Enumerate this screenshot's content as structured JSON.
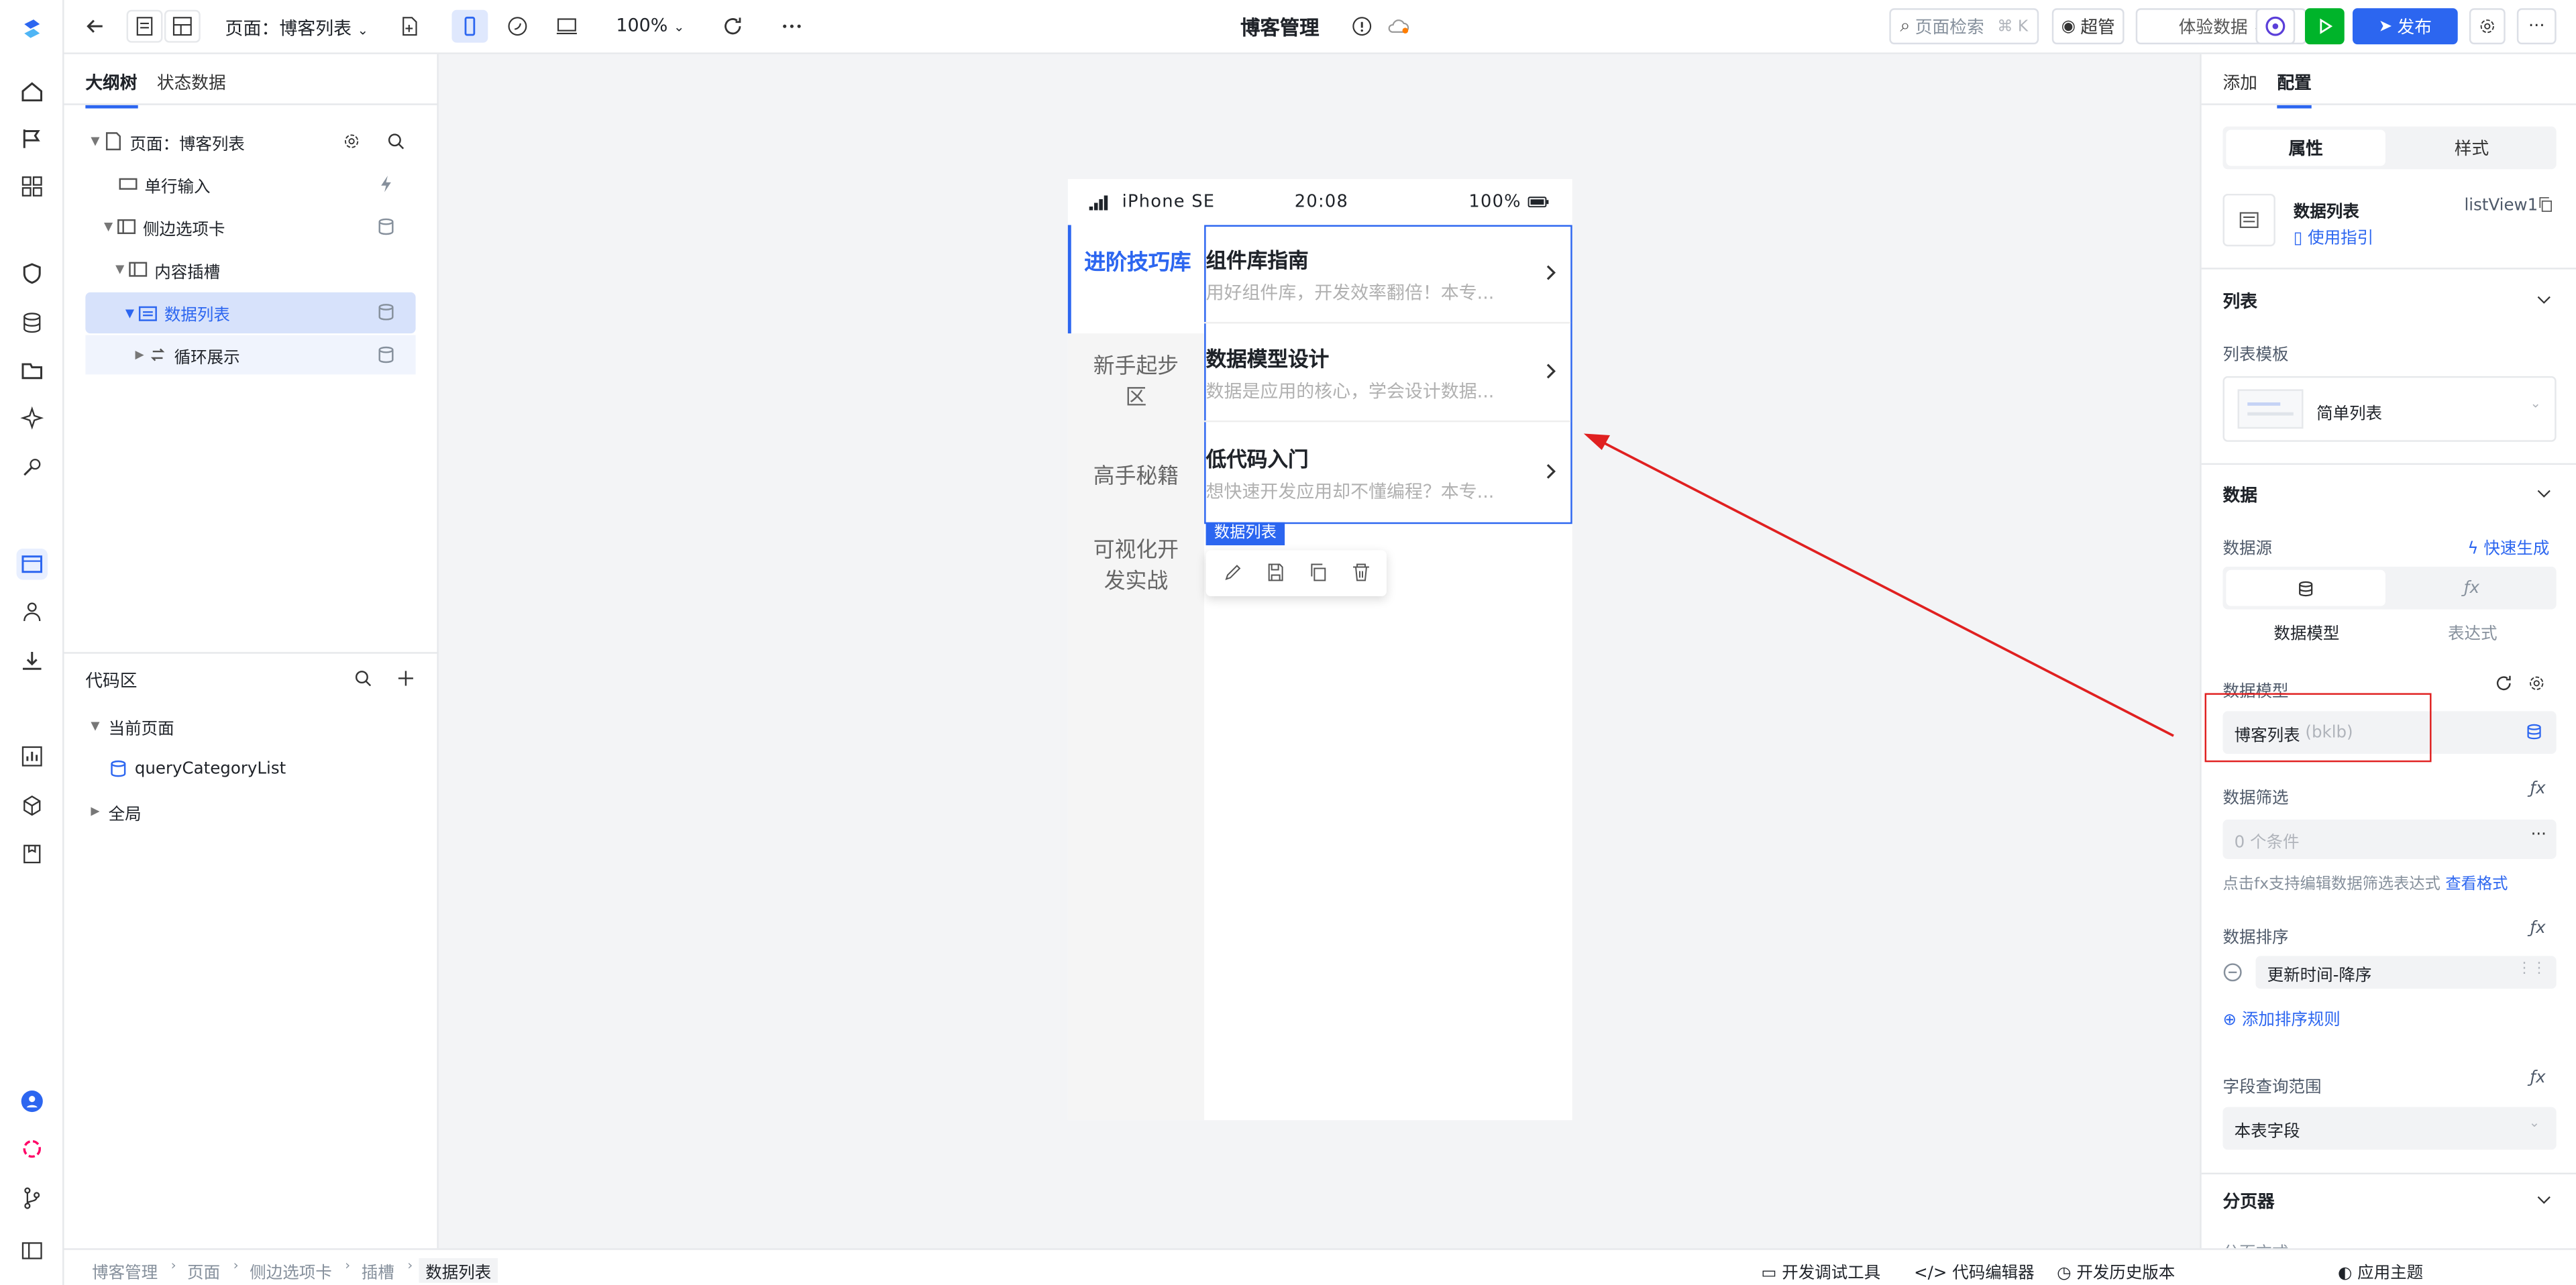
{
  "topbar": {
    "page_selector": "页面：博客列表",
    "zoom": "100%",
    "app_title": "博客管理",
    "page_search": "页面检索",
    "search_shortcut": "⌘ K",
    "user": "超管",
    "data_mode": "体验数据",
    "publish": "发布"
  },
  "outline": {
    "tab_tree": "大纲树",
    "tab_state": "状态数据",
    "nodes": [
      "页面：博客列表",
      "单行输入",
      "侧边选项卡",
      "内容插槽",
      "数据列表",
      "循环展示"
    ],
    "code_area_title": "代码区",
    "code_current_page": "当前页面",
    "code_item": "queryCategoryList",
    "code_global": "全局"
  },
  "phone": {
    "device": "iPhone SE",
    "time": "20:08",
    "battery": "100%",
    "side_tabs": [
      "进阶技巧库",
      "新手起步区",
      "高手秘籍",
      "可视化开发实战"
    ],
    "list_items": [
      {
        "title": "组件库指南",
        "desc": "用好组件库，开发效率翻倍！本专..."
      },
      {
        "title": "数据模型设计",
        "desc": "数据是应用的核心，学会设计数据..."
      },
      {
        "title": "低代码入门",
        "desc": "想快速开发应用却不懂编程？本专..."
      }
    ],
    "selection_tag": "数据列表"
  },
  "rpanel": {
    "tab_add": "添加",
    "tab_config": "配置",
    "seg_props": "属性",
    "seg_style": "样式",
    "comp_name": "数据列表",
    "comp_guide": "使用指引",
    "comp_id": "listView1",
    "sec_list": "列表",
    "list_template_label": "列表模板",
    "list_template_value": "简单列表",
    "sec_data": "数据",
    "datasource_label": "数据源",
    "quick_generate": "快速生成",
    "ds_model": "数据模型",
    "ds_expr": "表达式",
    "data_model_label": "数据模型",
    "data_model_value": "博客列表",
    "data_model_code": "(bklb)",
    "filter_label": "数据筛选",
    "filter_value": "0 个条件",
    "filter_hint": "点击fx支持编辑数据筛选表达式",
    "filter_hint_link": "查看格式",
    "sort_label": "数据排序",
    "sort_value": "更新时间-降序",
    "add_sort": "添加排序规则",
    "field_range_label": "字段查询范围",
    "field_range_value": "本表字段",
    "sec_pager": "分页器",
    "pager_sub": "分页方式"
  },
  "bottombar": {
    "breadcrumbs": [
      "博客管理",
      "页面",
      "侧边选项卡",
      "插槽",
      "数据列表"
    ],
    "dev_tools": "开发调试工具",
    "code_editor": "代码编辑器",
    "history": "开发历史版本",
    "theme": "应用主题"
  },
  "colors": {
    "accent": "#2c66f0",
    "annotation": "#e02020",
    "publish_green": "#00b42a"
  }
}
